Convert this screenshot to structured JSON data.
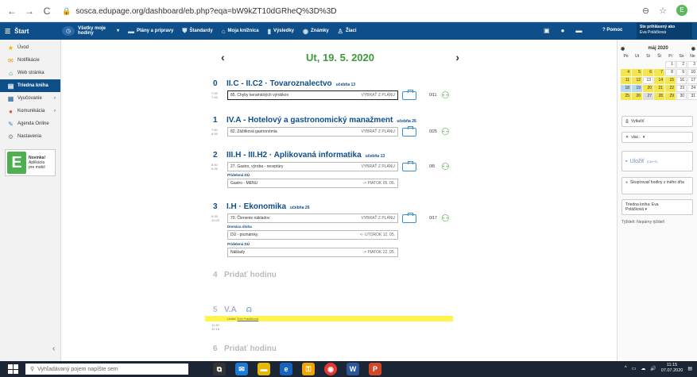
{
  "browser": {
    "back": "←",
    "forward": "→",
    "reload": "C",
    "url": "sosca.edupage.org/dashboard/eb.php?eqa=bW9kZT10dGRheQ%3D%3D",
    "avatar_letter": "E"
  },
  "topnav": {
    "brand": "Štart",
    "items": [
      {
        "label": "Všetky moje hodiny",
        "icon": "clock-icon"
      },
      {
        "label": "Plány a prípravy",
        "icon": "list-icon"
      },
      {
        "label": "Štandardy",
        "icon": "shield-icon"
      },
      {
        "label": "Moja knižnica",
        "icon": "library-icon"
      },
      {
        "label": "Výsledky",
        "icon": "chart-icon"
      },
      {
        "label": "Známky",
        "icon": "grade-icon"
      },
      {
        "label": "Žiaci",
        "icon": "students-icon"
      }
    ],
    "help": "Pomoc",
    "user_line1": "Ste prihlásený ako",
    "user_line2": "Eva Poláčková"
  },
  "sidebar": {
    "items": [
      {
        "label": "Úvod",
        "icon": "star-icon",
        "color": "#f0b400"
      },
      {
        "label": "Notifikácie",
        "icon": "mail-icon",
        "color": "#f08c00"
      },
      {
        "label": "Web stránka",
        "icon": "home-icon",
        "color": "#2e8b57"
      },
      {
        "label": "Triedna kniha",
        "icon": "book-icon",
        "color": "#ffffff"
      },
      {
        "label": "Vyučovanie",
        "icon": "teaching-icon",
        "color": "#0e4f8a"
      },
      {
        "label": "Komunikácia",
        "icon": "chat-icon",
        "color": "#d9534f"
      },
      {
        "label": "Agenda Online",
        "icon": "pen-icon",
        "color": "#4a7fbf"
      },
      {
        "label": "Nastavenia",
        "icon": "gear-icon",
        "color": "#888888"
      }
    ],
    "promo_title": "Novinka!",
    "promo_line2": "Aplikácia",
    "promo_line3": "pre mobil",
    "promo_logo": "E"
  },
  "main": {
    "date_title": "Ut, 19. 5. 2020",
    "lessons": [
      {
        "num": "0",
        "title": "II.C - II.C2 · Tovaroznalectvo",
        "room": "učebňa 13",
        "time": "7:05\n7:45",
        "topic": "85. Chyby keramických výrobkov",
        "plan": "VYBRAŤ Z PLÁNU",
        "count": "0/11"
      },
      {
        "num": "1",
        "title": "IV.A - Hotelový a gastronomický manažment",
        "room": "učebňa 26",
        "time": "7:50\n8:35",
        "topic": "82. Zážitková gastronómia",
        "plan": "VYBRAŤ Z PLÁNU",
        "count": "0/25"
      },
      {
        "num": "2",
        "title": "III.H - III.H2 · Aplikovaná informatika",
        "room": "učebňa 13",
        "time": "8:40\n9:25",
        "topic": "27. Gastro, výroba - receptúry",
        "plan": "VYBRAŤ Z PLÁNU",
        "count": "0/8",
        "sub_label": "Pridelená DÚ",
        "sub_text": "Gastro - MENU",
        "sub_right": "-> PIATOK 05. 06."
      },
      {
        "num": "3",
        "title": "I.H · Ekonomika",
        "room": "učebňa 26",
        "time": "9:35\n10:20",
        "topic": "70. Členenie nákladov",
        "plan": "VYBRAŤ Z PLÁNU",
        "count": "0/17",
        "sub_label": "Domáca úloha",
        "sub_text": "DÚ - poznámky",
        "sub_right": "<- UTOROK 12. 05.",
        "sub2_label": "Pridelená DÚ",
        "sub2_text": "Náklady",
        "sub2_right": "-> PIATOK 22. 05."
      }
    ],
    "add4_num": "4",
    "add4": "Pridať hodinu",
    "l5_num": "5",
    "l5_title": "V.A",
    "l5_teacher_label": "Učiteľ:",
    "l5_teacher": "Eva Poláčková",
    "l5_time": "11:30\n12:15",
    "add6_num": "6",
    "add6": "Pridať hodinu"
  },
  "rpanel": {
    "month": "máj 2020",
    "weekdays": [
      "Po",
      "Ut",
      "St",
      "Št",
      "Pi",
      "So",
      "Ne"
    ],
    "print": "Vytlačiť",
    "more": "viac..",
    "save": "Uložiť",
    "save_hint": "(Ctrl+S)",
    "copy": "Skopírovať hodiny z iného dňa",
    "book_line1": "Triedna kniha: Eva",
    "book_line2": "Poláčková ▾",
    "week_note": "Týždeň: Nepárny týždeň"
  },
  "taskbar": {
    "search_placeholder": "Vyhľadávaný pojem napíšte sem",
    "time": "11:15",
    "date": "07.07.2020"
  }
}
